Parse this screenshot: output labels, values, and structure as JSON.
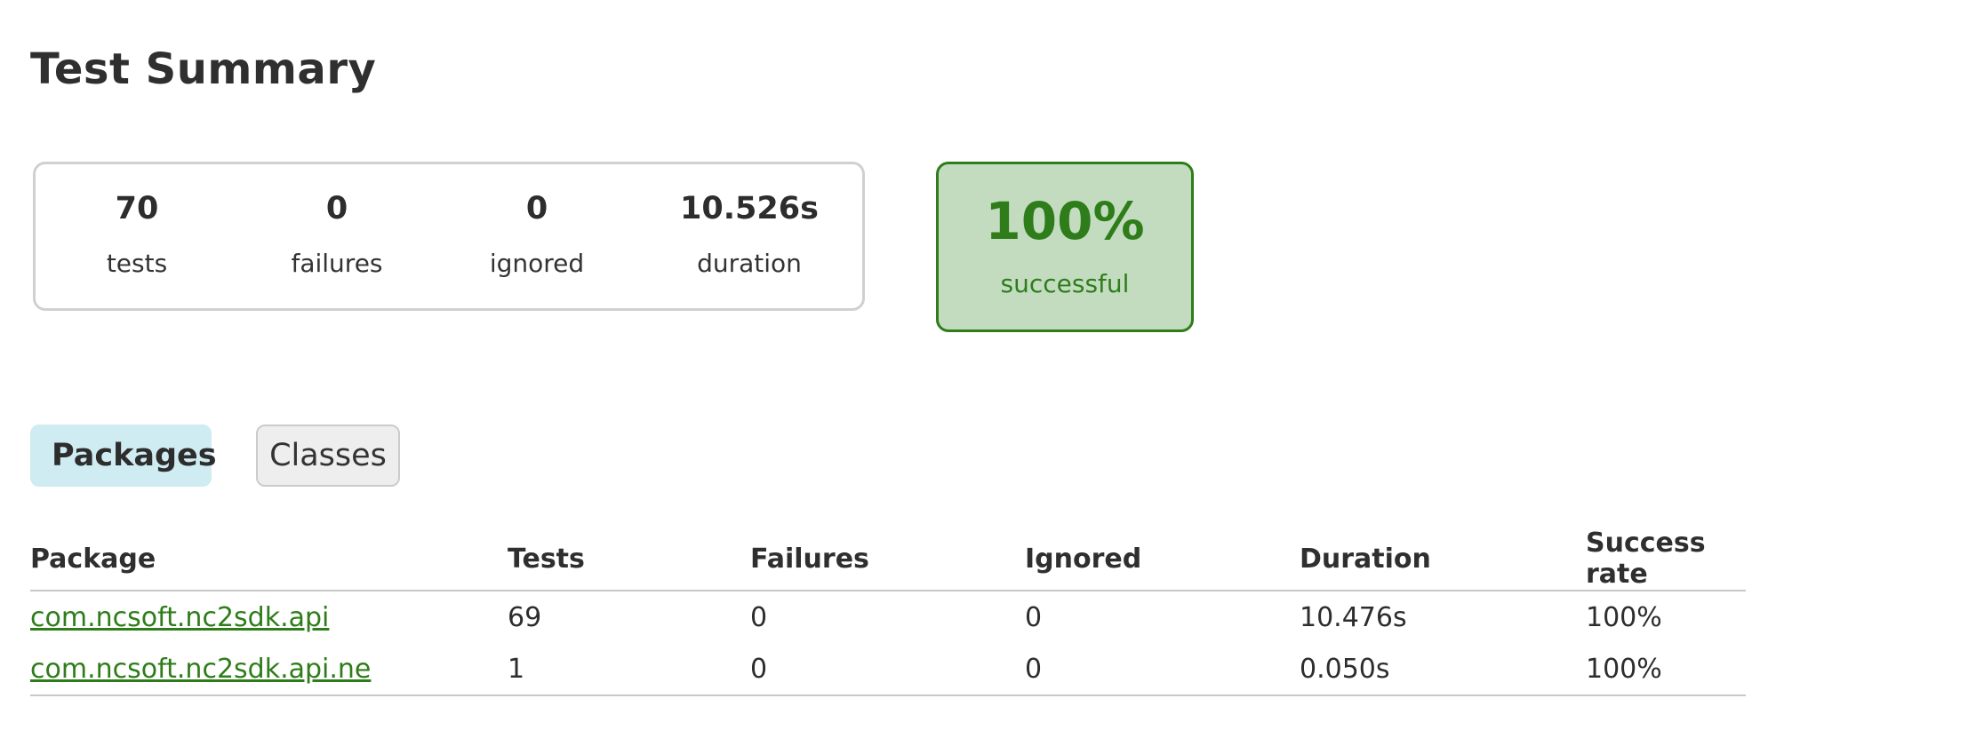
{
  "title": "Test Summary",
  "summary": {
    "tests": {
      "value": "70",
      "label": "tests"
    },
    "failures": {
      "value": "0",
      "label": "failures"
    },
    "ignored": {
      "value": "0",
      "label": "ignored"
    },
    "duration": {
      "value": "10.526s",
      "label": "duration"
    }
  },
  "success": {
    "value": "100%",
    "label": "successful"
  },
  "colors": {
    "success": "#2e7d1a",
    "success_bg": "#c3dcc0",
    "active_tab_bg": "#cfecf2"
  },
  "tabs": [
    {
      "label": "Packages",
      "active": true
    },
    {
      "label": "Classes",
      "active": false
    }
  ],
  "table": {
    "headers": [
      "Package",
      "Tests",
      "Failures",
      "Ignored",
      "Duration",
      "Success rate"
    ],
    "rows": [
      {
        "package": "com.ncsoft.nc2sdk.api",
        "tests": "69",
        "failures": "0",
        "ignored": "0",
        "duration": "10.476s",
        "success_rate": "100%"
      },
      {
        "package": "com.ncsoft.nc2sdk.api.ne",
        "tests": "1",
        "failures": "0",
        "ignored": "0",
        "duration": "0.050s",
        "success_rate": "100%"
      }
    ]
  }
}
